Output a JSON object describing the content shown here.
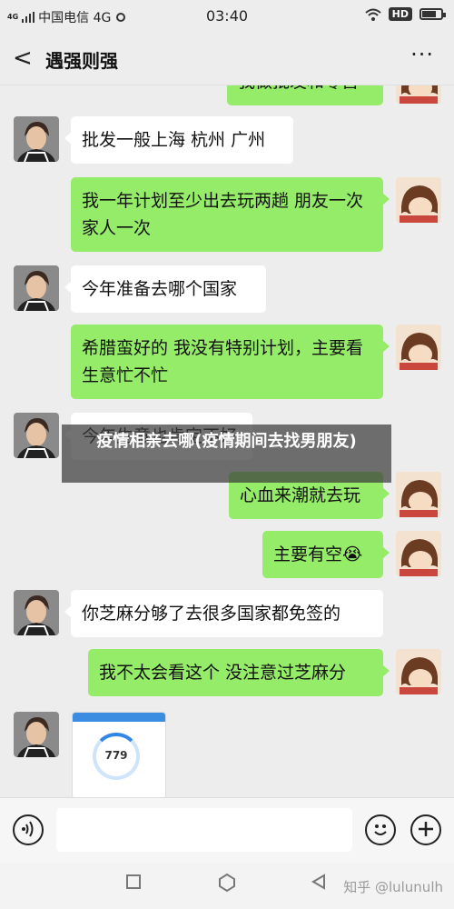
{
  "status": {
    "network_tag": "4G",
    "carrier": "中国电信 4G",
    "time": "03:40",
    "hd_badge": "HD",
    "battery_level": 0.7
  },
  "nav": {
    "back_glyph": "<",
    "title": "遇强则强",
    "more_glyph": "···"
  },
  "messages": [
    {
      "side": "out",
      "text": "我做批发和零售"
    },
    {
      "side": "in",
      "text": "批发一般上海 杭州 广州"
    },
    {
      "side": "out",
      "text": "我一年计划至少出去玩两趟 朋友一次  家人一次"
    },
    {
      "side": "in",
      "text": "今年准备去哪个国家"
    },
    {
      "side": "out",
      "text": "希腊蛮好的 我没有特别计划，主要看生意忙不忙"
    },
    {
      "side": "in",
      "text": "今年生意也肯定不好"
    },
    {
      "side": "out",
      "text": "心血来潮就去玩"
    },
    {
      "side": "out",
      "text": "主要有空😭"
    },
    {
      "side": "in",
      "text": "你芝麻分够了去很多国家都免签的"
    },
    {
      "side": "out",
      "text": "我不太会看这个 没注意过芝麻分"
    },
    {
      "side": "in",
      "type": "image",
      "text": "779"
    }
  ],
  "overlay_title": "疫情相亲去哪(疫情期间去找男朋友)",
  "input_bar": {
    "voice_icon": "voice-icon",
    "emoji_icon": "emoji-icon",
    "plus_icon": "plus-icon"
  },
  "watermark": "知乎 @lulunulh",
  "colors": {
    "sent_bubble": "#95ec69",
    "received_bubble": "#ffffff",
    "background": "#ededed"
  }
}
